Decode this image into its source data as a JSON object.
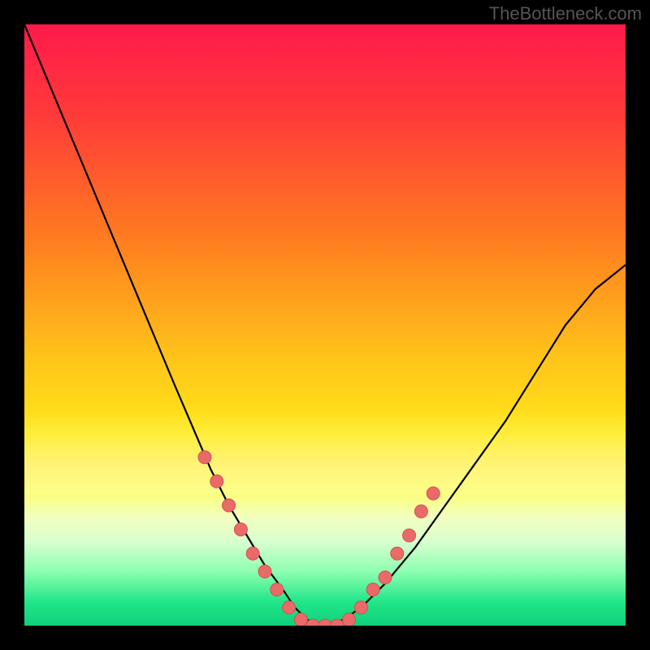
{
  "watermark": "TheBottleneck.com",
  "colors": {
    "frame": "#000000",
    "curve": "#000000",
    "dot_fill": "#ea6a6a",
    "dot_stroke": "#d84f4f"
  },
  "chart_data": {
    "type": "line",
    "title": "",
    "xlabel": "",
    "ylabel": "",
    "xlim": [
      0,
      100
    ],
    "ylim": [
      0,
      100
    ],
    "grid": false,
    "legend": false,
    "series": [
      {
        "name": "bottleneck-curve",
        "x": [
          0,
          5,
          10,
          15,
          20,
          25,
          28,
          31,
          34,
          37,
          40,
          43,
          45,
          47,
          49,
          51,
          53,
          56,
          60,
          65,
          70,
          75,
          80,
          85,
          90,
          95,
          100
        ],
        "y": [
          100,
          88,
          76,
          64,
          52,
          40,
          33,
          26,
          20,
          15,
          10,
          6,
          3,
          1,
          0,
          0,
          1,
          3,
          7,
          13,
          20,
          27,
          34,
          42,
          50,
          56,
          60
        ]
      }
    ],
    "markers": {
      "name": "highlight-dots",
      "points": [
        {
          "x": 30,
          "y": 28
        },
        {
          "x": 32,
          "y": 24
        },
        {
          "x": 34,
          "y": 20
        },
        {
          "x": 36,
          "y": 16
        },
        {
          "x": 38,
          "y": 12
        },
        {
          "x": 40,
          "y": 9
        },
        {
          "x": 42,
          "y": 6
        },
        {
          "x": 44,
          "y": 3
        },
        {
          "x": 46,
          "y": 1
        },
        {
          "x": 48,
          "y": 0
        },
        {
          "x": 50,
          "y": 0
        },
        {
          "x": 52,
          "y": 0
        },
        {
          "x": 54,
          "y": 1
        },
        {
          "x": 56,
          "y": 3
        },
        {
          "x": 58,
          "y": 6
        },
        {
          "x": 60,
          "y": 8
        },
        {
          "x": 62,
          "y": 12
        },
        {
          "x": 64,
          "y": 15
        },
        {
          "x": 66,
          "y": 19
        },
        {
          "x": 68,
          "y": 22
        }
      ]
    }
  }
}
